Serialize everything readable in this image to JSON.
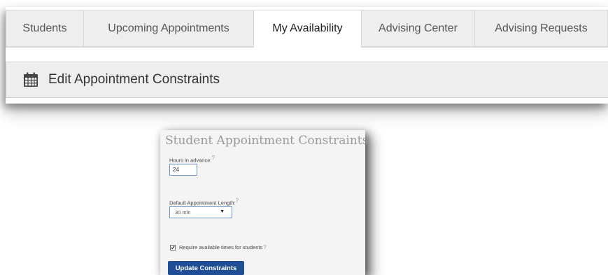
{
  "tabs": [
    {
      "label": "Students"
    },
    {
      "label": "Upcoming Appointments"
    },
    {
      "label": "My Availability",
      "active": true
    },
    {
      "label": "Advising Center"
    },
    {
      "label": "Advising Requests"
    }
  ],
  "header": {
    "icon": "calendar-icon",
    "title": "Edit Appointment Constraints"
  },
  "constraints_card": {
    "title": "Student Appointment Constraints",
    "hours_label": "Hours in advance:",
    "hours_value": "24",
    "length_label": "Default Appointment Length:",
    "length_value": "30 min",
    "require_label": "Require available times for students",
    "require_checked": true,
    "help_mark": "?",
    "button_label": "Update Constraints"
  },
  "colors": {
    "tab_bg": "#eeeeee",
    "header_bg": "#eeeeee",
    "button_bg": "#1f4e96",
    "input_border": "#6a93c9"
  }
}
